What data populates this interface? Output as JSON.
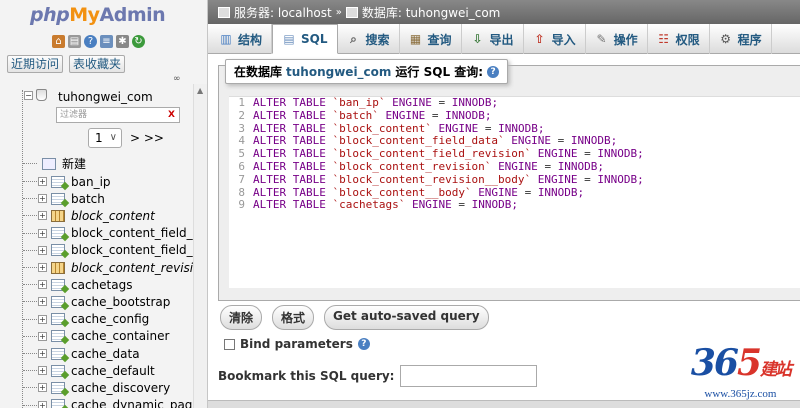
{
  "nav": {
    "logo": {
      "php": "php",
      "my": "My",
      "admin": "Admin"
    },
    "icons": [
      "home-icon",
      "exit-icon",
      "help-icon",
      "docs-icon",
      "settings-icon",
      "reload-icon"
    ],
    "links": [
      "近期访问",
      "表收藏夹"
    ],
    "collapse_label": "∞",
    "database": "tuhongwei_com",
    "filter_placeholder": "过滤器",
    "filter_clear": "X",
    "page_select": "1",
    "page_next": "> >>",
    "new_label": "新建",
    "tables": [
      {
        "name": "ban_ip",
        "view": false
      },
      {
        "name": "batch",
        "view": false
      },
      {
        "name": "block_content",
        "view": true
      },
      {
        "name": "block_content_field_da",
        "view": false
      },
      {
        "name": "block_content_field_rev",
        "view": false
      },
      {
        "name": "block_content_revision",
        "view": true
      },
      {
        "name": "cachetags",
        "view": false
      },
      {
        "name": "cache_bootstrap",
        "view": false
      },
      {
        "name": "cache_config",
        "view": false
      },
      {
        "name": "cache_container",
        "view": false
      },
      {
        "name": "cache_data",
        "view": false
      },
      {
        "name": "cache_default",
        "view": false
      },
      {
        "name": "cache_discovery",
        "view": false
      },
      {
        "name": "cache_dynamic_page",
        "view": false
      }
    ]
  },
  "breadcrumb": {
    "server": "服务器: localhost",
    "sep": "»",
    "database": "数据库: tuhongwei_com"
  },
  "tabs": [
    {
      "label": "结构",
      "icon": "structure-icon"
    },
    {
      "label": "SQL",
      "icon": "sql-icon",
      "active": true
    },
    {
      "label": "搜索",
      "icon": "search-icon"
    },
    {
      "label": "查询",
      "icon": "query-icon"
    },
    {
      "label": "导出",
      "icon": "export-icon"
    },
    {
      "label": "导入",
      "icon": "import-icon"
    },
    {
      "label": "操作",
      "icon": "operations-icon"
    },
    {
      "label": "权限",
      "icon": "privileges-icon"
    },
    {
      "label": "程序",
      "icon": "routines-icon"
    }
  ],
  "sql_panel": {
    "legend_prefix": "在数据库",
    "legend_db": "tuhongwei_com",
    "legend_suffix": "运行 SQL 查询:",
    "lines": [
      {
        "n": "1",
        "table": "`ban_ip`"
      },
      {
        "n": "2",
        "table": "`batch`"
      },
      {
        "n": "3",
        "table": "`block_content`"
      },
      {
        "n": "4",
        "table": "`block_content_field_data`"
      },
      {
        "n": "5",
        "table": "`block_content_field_revision`"
      },
      {
        "n": "6",
        "table": "`block_content_revision`"
      },
      {
        "n": "7",
        "table": "`block_content_revision__body`"
      },
      {
        "n": "8",
        "table": "`block_content__body`"
      },
      {
        "n": "9",
        "table": "`cachetags`"
      }
    ],
    "kw_alter": "ALTER TABLE",
    "kw_engine": "ENGINE",
    "eq": "=",
    "engine_value": "INNODB;"
  },
  "buttons": {
    "clear": "清除",
    "format": "格式",
    "autosaved": "Get auto-saved query"
  },
  "bind_label": "Bind parameters",
  "bookmark_label": "Bookmark this SQL query:",
  "watermark": {
    "num_a": "36",
    "num_b": "5",
    "cn": "建站",
    "url": "www.365jz.com"
  },
  "colors": {
    "link": "#235a81",
    "keyword": "#770088",
    "string": "#aa1111",
    "nav_bg": "#f3f3f3"
  }
}
